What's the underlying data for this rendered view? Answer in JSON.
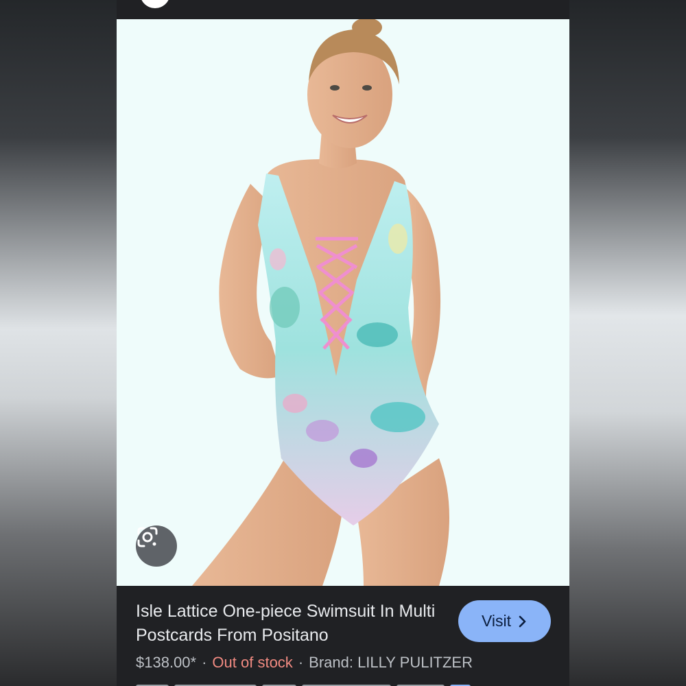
{
  "result": {
    "title": "Isle Lattice One-piece Swimsuit In Multi Postcards From Positano",
    "visit_label": "Visit",
    "price": "$138.00*",
    "separator": "·",
    "stock_status": "Out of stock",
    "brand": "Brand: LILLY PULITZER"
  },
  "icons": {
    "lens": "google-lens-icon",
    "visit_arrow": "chevron-right-icon"
  },
  "colors": {
    "visit_button": "#8ab4f8",
    "out_of_stock": "#f28b82",
    "panel_background": "#202124"
  }
}
